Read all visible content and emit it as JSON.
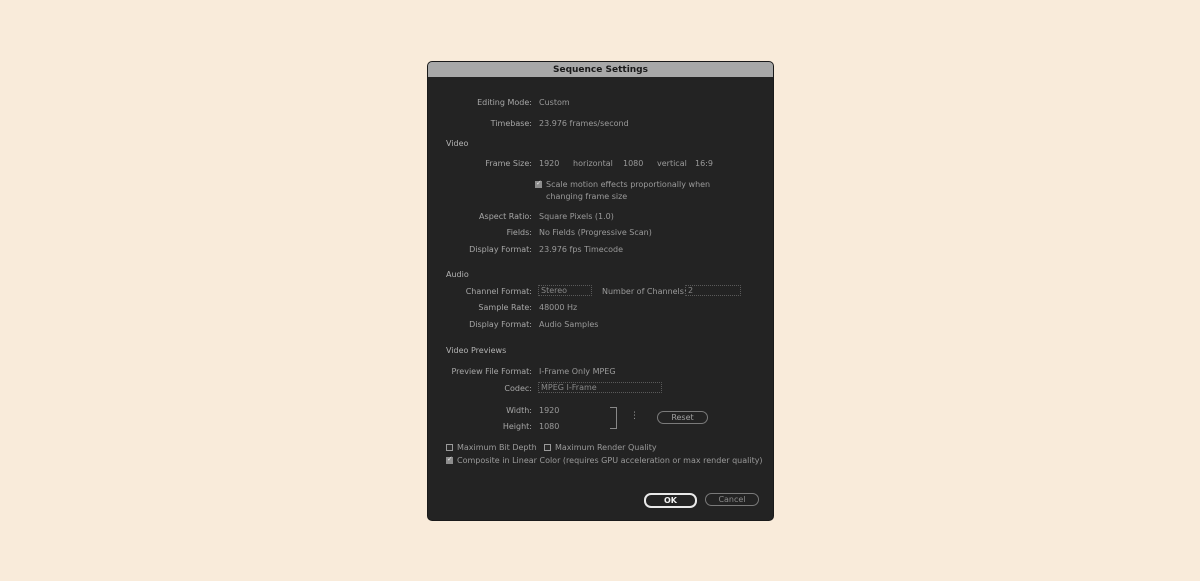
{
  "dialog": {
    "title": "Sequence Settings",
    "editing_mode": {
      "label": "Editing Mode:",
      "value": "Custom"
    },
    "timebase": {
      "label": "Timebase:",
      "value": "23.976  frames/second"
    },
    "video": {
      "section_label": "Video",
      "frame_size": {
        "label": "Frame Size:",
        "width": "1920",
        "horizontal": "horizontal",
        "height": "1080",
        "vertical": "vertical",
        "ratio": "16:9"
      },
      "scale_motion": {
        "checked": true,
        "text_line1": "Scale motion effects proportionally when",
        "text_line2": "changing frame size"
      },
      "aspect_ratio": {
        "label": "Aspect Ratio:",
        "value": "Square Pixels (1.0)"
      },
      "fields": {
        "label": "Fields:",
        "value": "No Fields (Progressive Scan)"
      },
      "display_format": {
        "label": "Display Format:",
        "value": "23.976 fps Timecode"
      }
    },
    "audio": {
      "section_label": "Audio",
      "channel_format": {
        "label": "Channel Format:",
        "value": "Stereo"
      },
      "num_channels": {
        "label": "Number of Channels:",
        "value": "2"
      },
      "sample_rate": {
        "label": "Sample Rate:",
        "value": "48000 Hz"
      },
      "display_format": {
        "label": "Display Format:",
        "value": "Audio Samples"
      }
    },
    "previews": {
      "section_label": "Video Previews",
      "file_format": {
        "label": "Preview File Format:",
        "value": "I-Frame Only MPEG"
      },
      "codec": {
        "label": "Codec:",
        "value": "MPEG I-Frame"
      },
      "width": {
        "label": "Width:",
        "value": "1920"
      },
      "height": {
        "label": "Height:",
        "value": "1080"
      },
      "reset_label": "Reset"
    },
    "options": {
      "max_bit_depth": {
        "label": "Maximum Bit Depth",
        "checked": false
      },
      "max_render_quality": {
        "label": "Maximum Render Quality",
        "checked": false
      },
      "linear_color": {
        "label": "Composite in Linear Color (requires GPU acceleration or max render quality)",
        "checked": true
      }
    },
    "ok_label": "OK",
    "cancel_label": "Cancel"
  }
}
